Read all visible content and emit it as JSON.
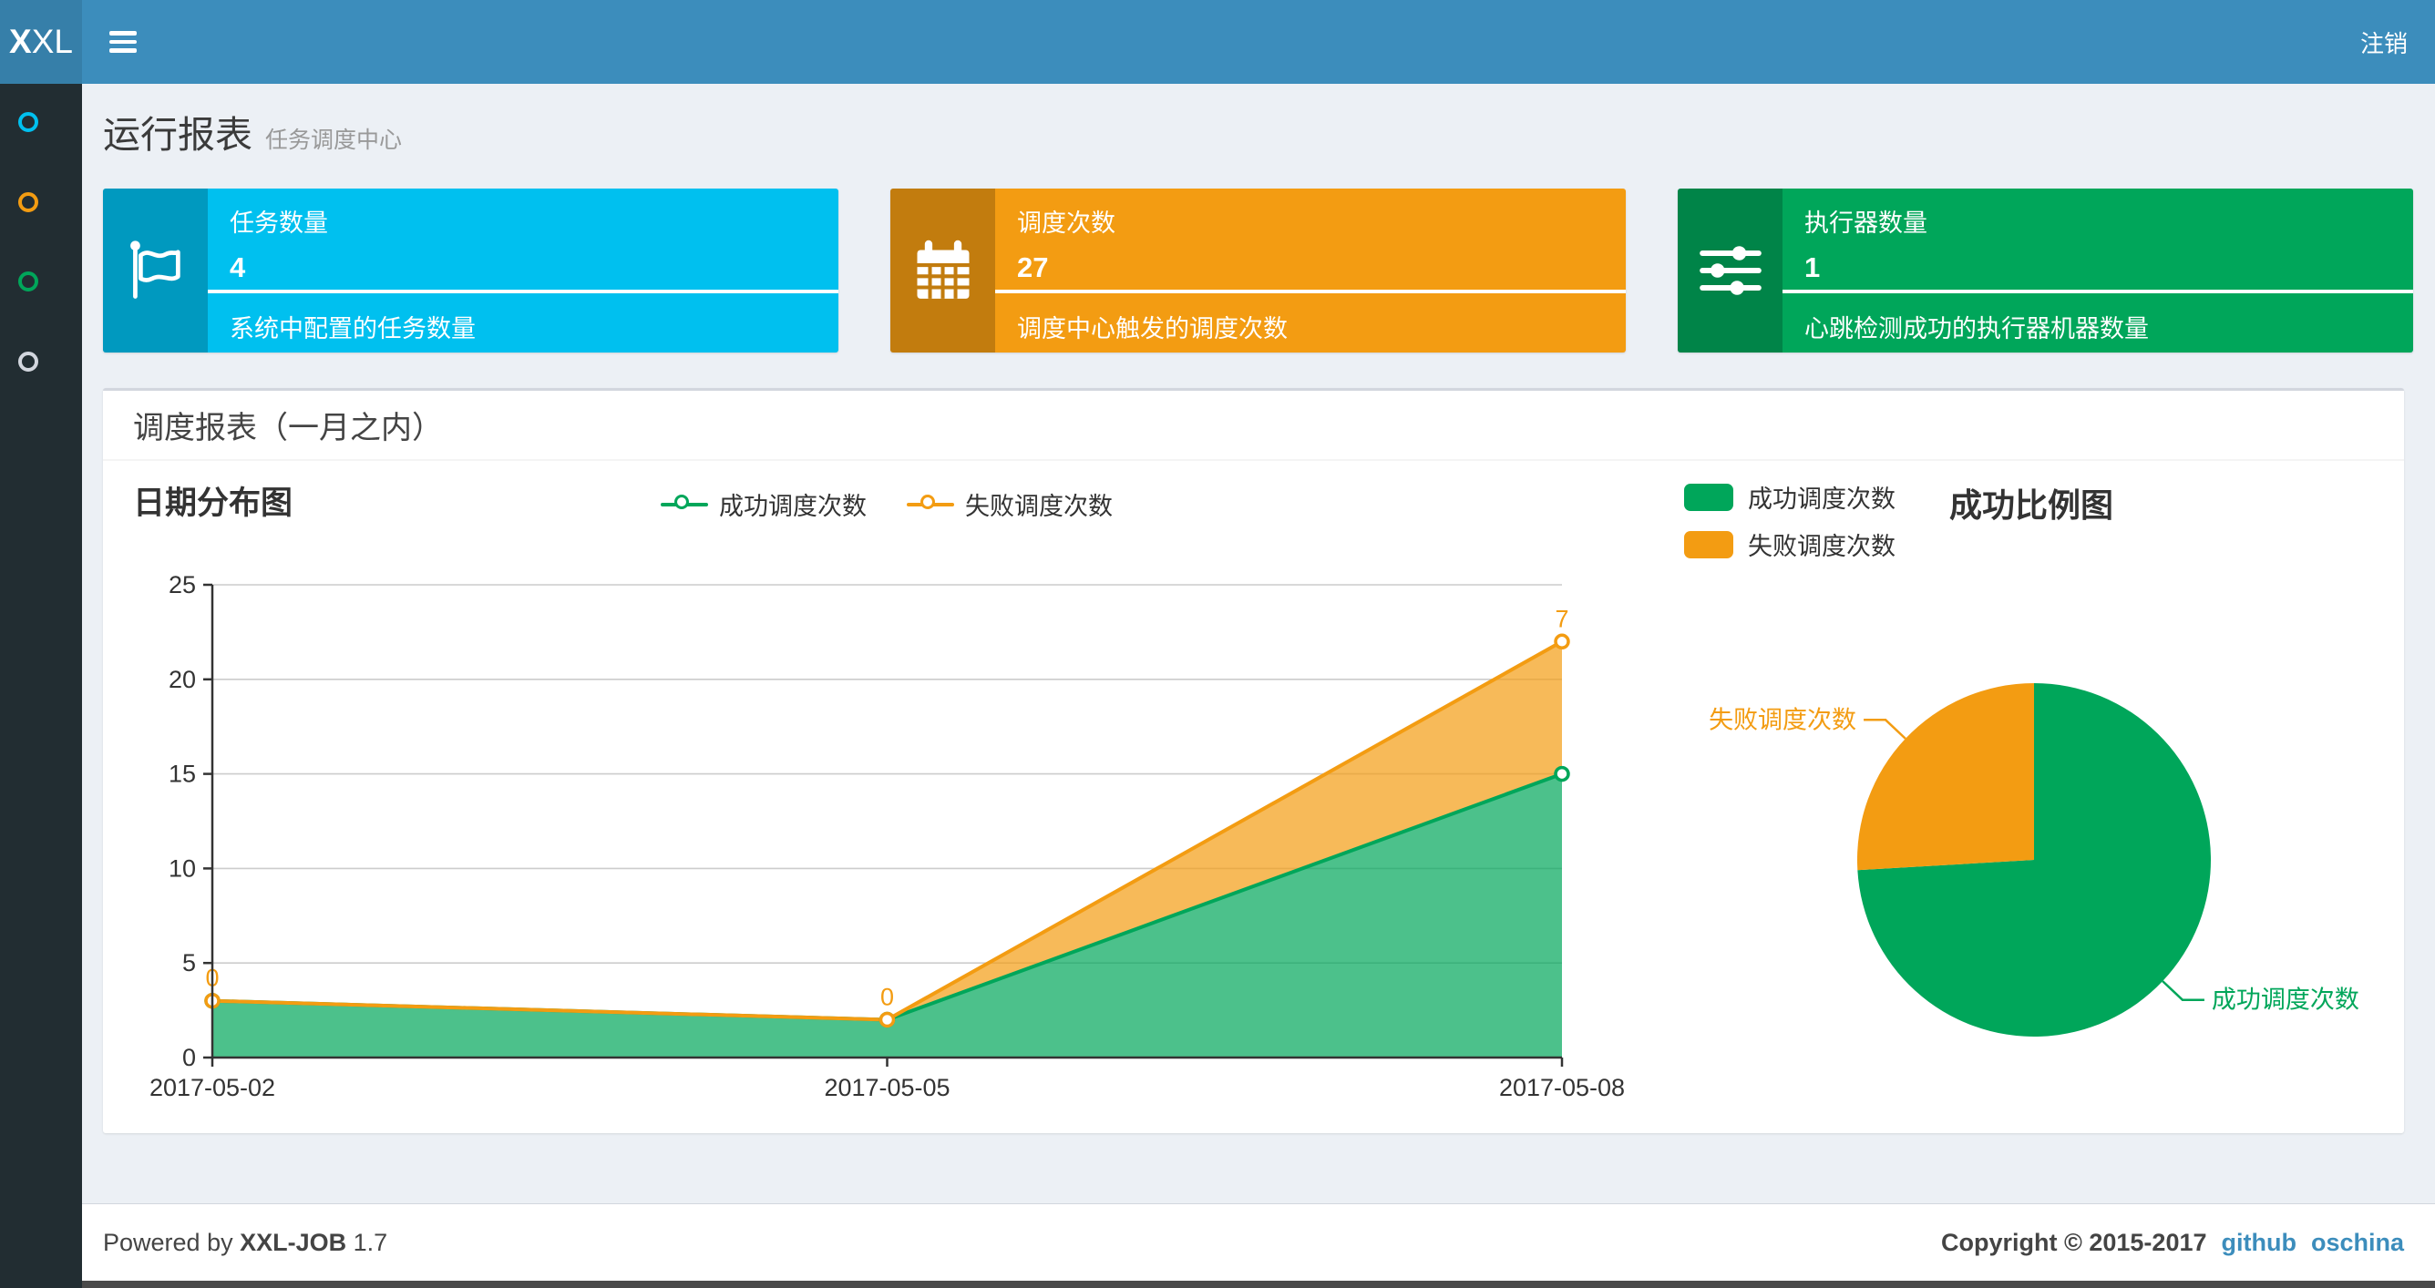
{
  "navbar": {
    "logo_bold": "X",
    "logo_rest": "XL",
    "logout": "注销"
  },
  "sidebar": {
    "items": [
      {
        "name": "menu-item-1",
        "color": "#00c0ef"
      },
      {
        "name": "menu-item-2",
        "color": "#f39c12"
      },
      {
        "name": "menu-item-3",
        "color": "#00a65a"
      },
      {
        "name": "menu-item-4",
        "color": "#d2d6de"
      }
    ]
  },
  "page": {
    "title": "运行报表",
    "subtitle": "任务调度中心"
  },
  "info_boxes": [
    {
      "title": "任务数量",
      "value": "4",
      "desc": "系统中配置的任务数量",
      "color": "#00c0ef",
      "icon": "flag-icon"
    },
    {
      "title": "调度次数",
      "value": "27",
      "desc": "调度中心触发的调度次数",
      "color": "#f39c12",
      "icon": "calendar-icon"
    },
    {
      "title": "执行器数量",
      "value": "1",
      "desc": "心跳检测成功的执行器机器数量",
      "color": "#00a65a",
      "icon": "sliders-icon"
    }
  ],
  "panel": {
    "title": "调度报表（一月之内）"
  },
  "chart_data": [
    {
      "type": "area",
      "title": "日期分布图",
      "x": [
        "2017-05-02",
        "2017-05-05",
        "2017-05-08"
      ],
      "stacked": true,
      "series": [
        {
          "name": "成功调度次数",
          "color": "#00a65a",
          "values": [
            3,
            2,
            15
          ]
        },
        {
          "name": "失败调度次数",
          "color": "#f39c12",
          "values": [
            0,
            0,
            7
          ],
          "point_labels": [
            "0",
            "0",
            "7"
          ]
        }
      ],
      "ylim": [
        0,
        25
      ],
      "yticks": [
        0,
        5,
        10,
        15,
        20,
        25
      ],
      "grid": true,
      "legend_position": "top-center"
    },
    {
      "type": "pie",
      "title": "成功比例图",
      "slices": [
        {
          "label": "成功调度次数",
          "color": "#00a65a",
          "value": 20
        },
        {
          "label": "失败调度次数",
          "color": "#f39c12",
          "value": 7
        }
      ],
      "legend_position": "top-left"
    }
  ],
  "footer": {
    "powered_prefix": "Powered by",
    "product": "XXL-JOB",
    "version": "1.7",
    "copyright": "Copyright © 2015-2017",
    "links": [
      "github",
      "oschina"
    ]
  },
  "colors": {
    "navbar": "#3c8dbc",
    "logo_bg": "#367fa9",
    "sidebar": "#222d32",
    "content_bg": "#ecf0f5",
    "bottom_strip": "#4a4a4a",
    "success": "#00a65a",
    "warning": "#f39c12",
    "info": "#00c0ef",
    "link": "#3c8dbc",
    "axis": "#333333",
    "gridline": "#cccccc"
  }
}
